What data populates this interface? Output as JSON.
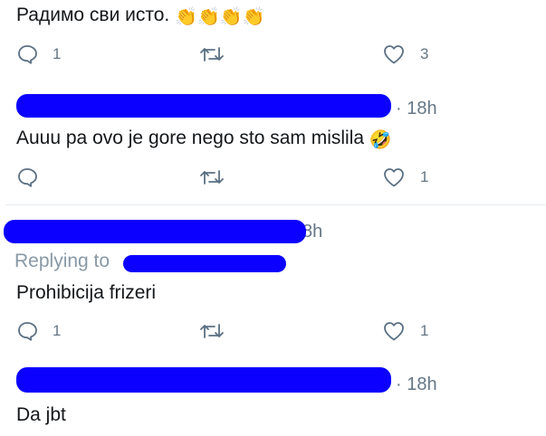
{
  "colors": {
    "text": "#14171a",
    "secondary": "#657786",
    "replying": "#8899a6",
    "icon": "#5b7083",
    "divider": "#e6ecf0",
    "redaction": "#0b00ff"
  },
  "tweets": [
    {
      "text": "Радимо сви исто.",
      "emoji": "👏👏👏👏",
      "actions": {
        "reply_count": "1",
        "retweet_count": "",
        "like_count": "3"
      }
    },
    {
      "time": "· 18h",
      "text": "Auuu pa ovo je gore nego sto sam mislila",
      "emoji": "🤣",
      "actions": {
        "reply_count": "",
        "retweet_count": "",
        "like_count": "1"
      }
    },
    {
      "time": "8h",
      "replying_label": "Replying to",
      "text": "Prohibicija frizeri",
      "actions": {
        "reply_count": "1",
        "retweet_count": "",
        "like_count": "1"
      }
    },
    {
      "time": "· 18h",
      "text": "Da jbt"
    }
  ]
}
